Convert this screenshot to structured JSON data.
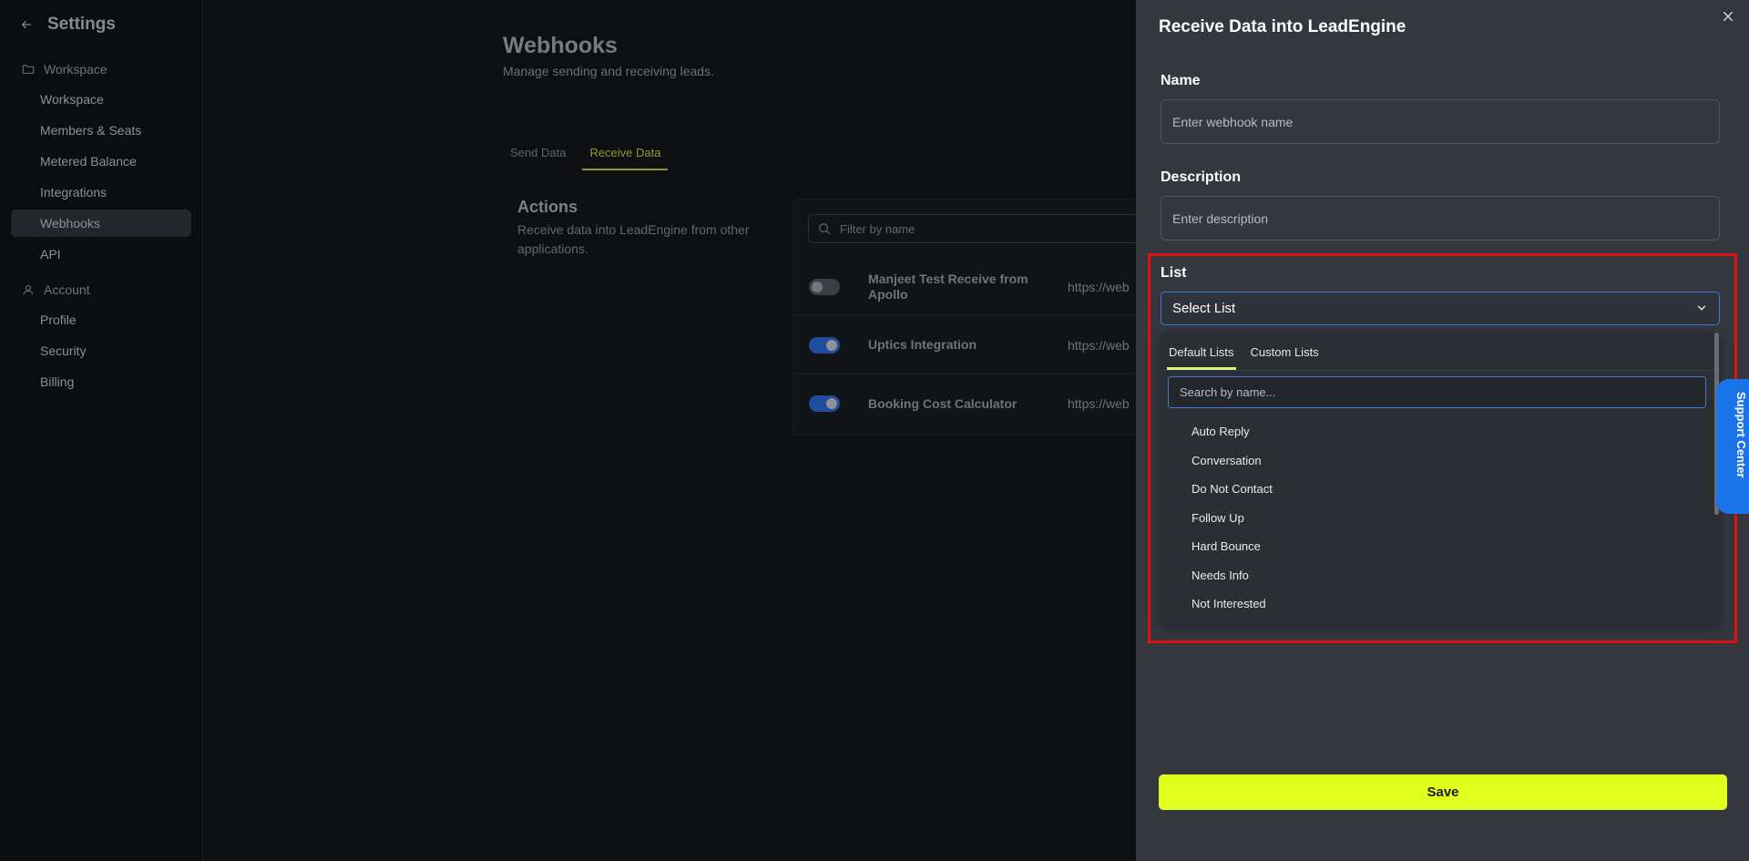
{
  "sidebar": {
    "title": "Settings",
    "sections": [
      {
        "label": "Workspace",
        "items": [
          "Workspace",
          "Members & Seats",
          "Metered Balance",
          "Integrations",
          "Webhooks",
          "API"
        ]
      },
      {
        "label": "Account",
        "items": [
          "Profile",
          "Security",
          "Billing"
        ]
      }
    ],
    "active_item": "Webhooks"
  },
  "main": {
    "title": "Webhooks",
    "subtitle": "Manage sending and receiving leads.",
    "tabs": [
      "Send Data",
      "Receive Data"
    ],
    "active_tab": "Receive Data",
    "actions": {
      "title": "Actions",
      "description": "Receive data into LeadEngine from other applications."
    },
    "filter_placeholder": "Filter by name",
    "webhooks": [
      {
        "name": "Manjeet Test Receive from Apollo",
        "url": "https://web",
        "enabled": false
      },
      {
        "name": "Uptics Integration",
        "url": "https://web",
        "enabled": true
      },
      {
        "name": "Booking Cost Calculator",
        "url": "https://web",
        "enabled": true
      }
    ]
  },
  "drawer": {
    "title": "Receive Data into LeadEngine",
    "name_label": "Name",
    "name_placeholder": "Enter webhook name",
    "description_label": "Description",
    "description_placeholder": "Enter description",
    "list_label": "List",
    "list_value": "Select List",
    "dropdown": {
      "tabs": [
        "Default Lists",
        "Custom Lists"
      ],
      "active_tab": "Default Lists",
      "search_placeholder": "Search by name...",
      "items": [
        "Auto Reply",
        "Conversation",
        "Do Not Contact",
        "Follow Up",
        "Hard Bounce",
        "Needs Info",
        "Not Interested"
      ]
    },
    "save_label": "Save"
  },
  "support_label": "Support Center",
  "colors": {
    "accent": "#e1ff1f",
    "focus": "#3d7ad6",
    "highlight": "#e01010",
    "toggle_on": "#1e4f9e",
    "support": "#1a73e8"
  }
}
